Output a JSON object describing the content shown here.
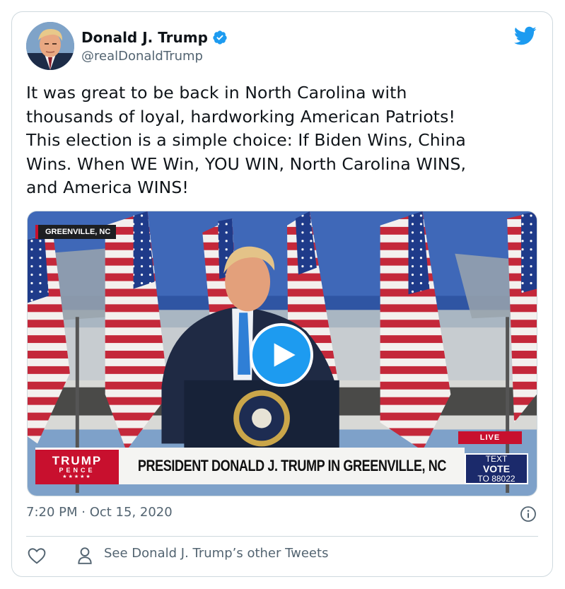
{
  "author": {
    "display_name": "Donald J. Trump",
    "handle": "@realDonaldTrump",
    "verified": true
  },
  "tweet": {
    "text": "It was great to be back in North Carolina with\nthousands of loyal, hardworking American Patriots!\nThis election is a simple choice: If Biden Wins, China\nWins. When WE Win, YOU WIN, North Carolina WINS,\nand America WINS!",
    "timestamp": "7:20 PM · Oct 15, 2020"
  },
  "video": {
    "location_tag": "GREENVILLE, NC",
    "logo_top": "TRUMP",
    "logo_sub": "PENCE",
    "logo_stars": "★★★★★",
    "headline": "PRESIDENT DONALD J. TRUMP IN GREENVILLE, NC",
    "live_label": "LIVE",
    "vote_line1": "TEXT",
    "vote_line2": "VOTE",
    "vote_line3": "TO 88022"
  },
  "footer": {
    "other_tweets_label": "See Donald J. Trump’s other Tweets"
  },
  "icons": [
    "verified-badge-icon",
    "twitter-bird-icon",
    "play-icon",
    "info-icon",
    "heart-icon",
    "person-icon"
  ],
  "colors": {
    "accent": "#1d9bf0",
    "text": "#0f1419",
    "secondary_text": "#536471",
    "border": "#cfd9de",
    "brand_red": "#c8102e",
    "vote_blue": "#1b2a6b"
  }
}
